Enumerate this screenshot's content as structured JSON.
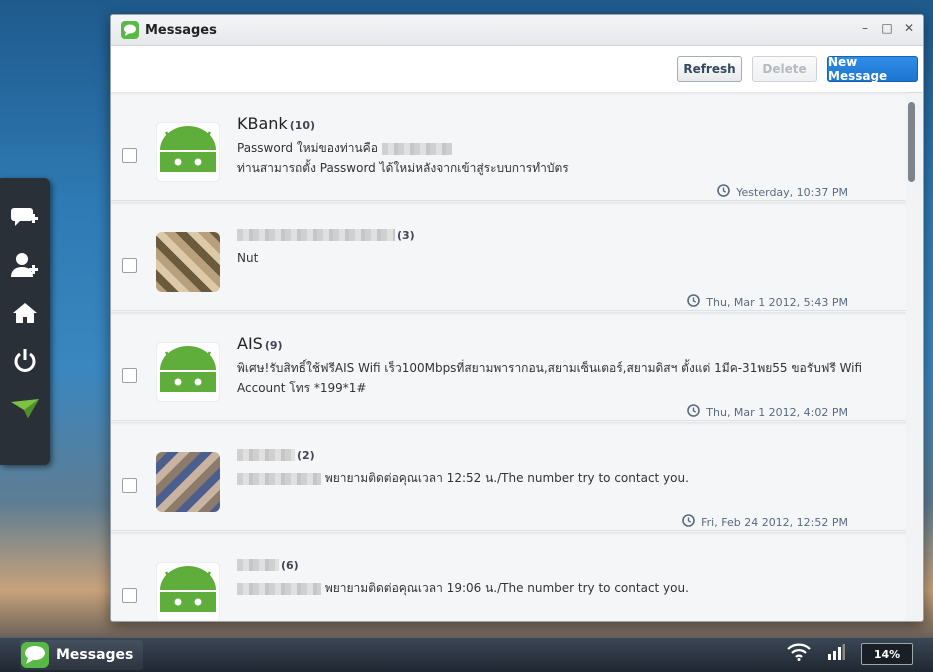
{
  "window": {
    "title": "Messages"
  },
  "toolbar": {
    "refresh_label": "Refresh",
    "delete_label": "Delete",
    "new_label": "New Message"
  },
  "messages": [
    {
      "sender": "KBank",
      "count": "(10)",
      "line1": "Password ใหม่ของท่านคือ",
      "line2": "ท่านสามารถตั้ง Password ได้ใหม่หลังจากเข้าสู่ระบบการทำบัตร",
      "time": "Yesterday, 10:37 PM"
    },
    {
      "sender": "",
      "count": "(3)",
      "line1": "Nut",
      "line2": "",
      "time": "Thu, Mar 1 2012, 5:43 PM"
    },
    {
      "sender": "AIS",
      "count": "(9)",
      "line1": "พิเศษ!รับสิทธิ์ใช้ฟรีAIS Wifi เร็ว100Mbpsที่สยามพารากอน,สยามเซ็นเตอร์,สยามดิสฯ ตั้งแต่ 1มีค-31พย55 ขอรับฟรี Wifi",
      "line2": "Account โทร *199*1#",
      "time": "Thu, Mar 1 2012, 4:02 PM"
    },
    {
      "sender": "",
      "count": "(2)",
      "line1": "พยายามติดต่อคุณเวลา 12:52 น./The number try to contact you.",
      "line2": "",
      "time": "Fri, Feb 24 2012, 12:52 PM"
    },
    {
      "sender": "",
      "count": "(6)",
      "line1": "พยายามติดต่อคุณเวลา 19:06 น./The number try to contact you.",
      "line2": "",
      "time": ""
    }
  ],
  "taskbar": {
    "app_label": "Messages",
    "battery": "14%"
  },
  "colors": {
    "accent": "#1c74cf",
    "android_green": "#5fae3b"
  }
}
